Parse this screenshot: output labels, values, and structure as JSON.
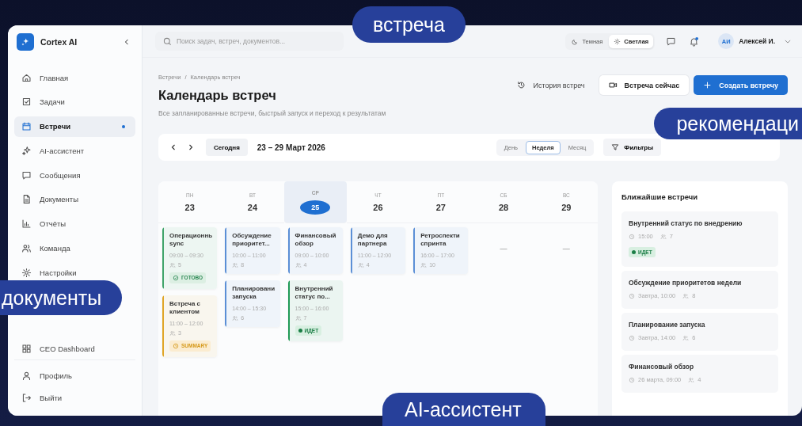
{
  "sidebar": {
    "brand": "Cortex AI",
    "items": [
      {
        "label": "Главная",
        "selected": false
      },
      {
        "label": "Задачи",
        "selected": false
      },
      {
        "label": "Встречи",
        "selected": true
      },
      {
        "label": "AI-ассистент",
        "selected": false
      },
      {
        "label": "Сообщения",
        "selected": false
      },
      {
        "label": "Документы",
        "selected": false
      },
      {
        "label": "Отчёты",
        "selected": false
      },
      {
        "label": "Команда",
        "selected": false
      },
      {
        "label": "Настройки",
        "selected": false
      }
    ],
    "admin_items": [
      {
        "label": "CEO Dashboard",
        "selected": false
      }
    ],
    "footer_items": [
      {
        "label": "Профиль"
      },
      {
        "label": "Выйти"
      }
    ]
  },
  "topbar": {
    "search": {
      "placeholder": "Поиск задач, встреч, документов..."
    },
    "theme": [
      {
        "label": "Темная",
        "selected": false
      },
      {
        "label": "Светлая",
        "selected": true
      }
    ],
    "notifications": {
      "unread": true
    },
    "user": {
      "initials": "АИ",
      "name": "Алексей И."
    }
  },
  "header": {
    "breadcrumb": [
      "Встречи",
      "Календарь встреч"
    ],
    "breadcrumb_separator": "/",
    "title": "Календарь встреч",
    "subtitle": "Все запланированные встречи, быстрый запуск и переход к результатам",
    "actions": [
      {
        "label": "История встреч",
        "kind": "link"
      },
      {
        "label": "Встреча сейчас",
        "kind": "secondary"
      },
      {
        "label": "Создать встречу",
        "kind": "primary"
      }
    ]
  },
  "toolbar": {
    "today": "Сегодня",
    "range": "23 – 29 Март 2026",
    "views": [
      {
        "label": "День",
        "selected": false
      },
      {
        "label": "Неделя",
        "selected": true
      },
      {
        "label": "Месяц",
        "selected": false
      }
    ],
    "filter": "Фильтры"
  },
  "days": [
    {
      "dow": "ПН",
      "date": "23",
      "today": false,
      "events": [
        {
          "title": "Операционнь sync",
          "time": "09:00 – 09:30",
          "people": "5",
          "color": "#3fa46a",
          "status": {
            "label": "ГОТОВО",
            "kind": "done"
          }
        },
        {
          "title": "Встреча с клиентом",
          "time": "11:00 – 12:00",
          "people": "3",
          "color": "#e0a526",
          "status": {
            "label": "SUMMARY",
            "kind": "summary"
          }
        }
      ]
    },
    {
      "dow": "ВТ",
      "date": "24",
      "today": false,
      "events": [
        {
          "title": "Обсуждение приоритет...",
          "time": "10:00 – 11:00",
          "people": "8",
          "color": "#5b8fd6"
        },
        {
          "title": "Планировани запуска",
          "time": "14:00 – 15:30",
          "people": "6",
          "color": "#5b8fd6"
        }
      ]
    },
    {
      "dow": "СР",
      "date": "25",
      "today": true,
      "events": [
        {
          "title": "Финансовый обзор",
          "time": "09:00 – 10:00",
          "people": "4",
          "color": "#5b8fd6"
        },
        {
          "title": "Внутренний статус по...",
          "time": "15:00 – 16:00",
          "people": "7",
          "color": "#1f9a55",
          "status": {
            "label": "ИДЕТ",
            "kind": "live"
          }
        }
      ]
    },
    {
      "dow": "ЧТ",
      "date": "26",
      "today": false,
      "events": [
        {
          "title": "Демо для партнера",
          "time": "11:00 – 12:00",
          "people": "4",
          "color": "#5b8fd6"
        }
      ]
    },
    {
      "dow": "ПТ",
      "date": "27",
      "today": false,
      "events": [
        {
          "title": "Ретроспекти спринта",
          "time": "16:00 – 17:00",
          "people": "10",
          "color": "#5b8fd6"
        }
      ]
    },
    {
      "dow": "СБ",
      "date": "28",
      "today": false,
      "empty_mark": "—"
    },
    {
      "dow": "ВС",
      "date": "29",
      "today": false,
      "empty_mark": "—"
    }
  ],
  "upcoming": {
    "title": "Ближайшие встречи",
    "items": [
      {
        "title": "Внутренний статус по внедрению",
        "time": "15:00",
        "people": "7",
        "status": {
          "label": "ИДЕТ",
          "kind": "live"
        }
      },
      {
        "title": "Обсуждение приоритетов недели",
        "time": "Завтра, 10:00",
        "people": "8"
      },
      {
        "title": "Планирование запуска",
        "time": "Завтра, 14:00",
        "people": "6"
      },
      {
        "title": "Финансовый обзор",
        "time": "26 марта, 09:00",
        "people": "4"
      }
    ]
  },
  "captions": [
    {
      "text": "встреча"
    },
    {
      "text": "рекомендаци"
    },
    {
      "text": "документы"
    },
    {
      "text": "AI-ассистент"
    }
  ]
}
